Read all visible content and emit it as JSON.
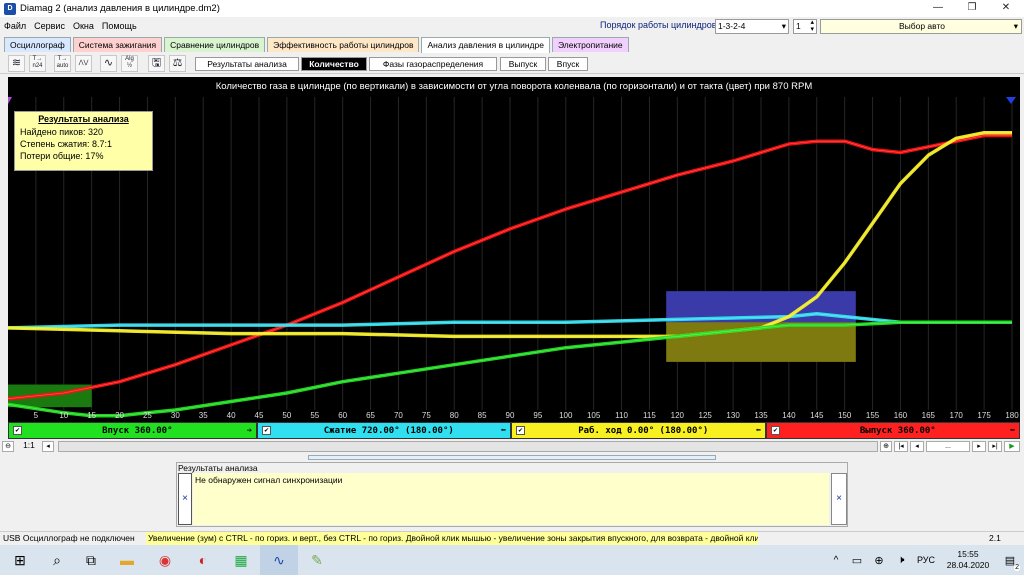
{
  "window": {
    "title": "Diamag 2 (анализ давления в цилиндре.dm2)",
    "minimize": "—",
    "maximize": "❐",
    "close": "✕"
  },
  "menu": [
    "Файл",
    "Сервис",
    "Окна",
    "Помощь"
  ],
  "cylinder_order": {
    "label": "Порядок работы цилиндров",
    "order_value": "1-3-2-4",
    "cylinder_value": "1",
    "auto_select": "Выбор авто"
  },
  "tabs": [
    {
      "label": "Осциллограф",
      "color": "#d7e8ff"
    },
    {
      "label": "Система зажигания",
      "color": "#ffd0d0"
    },
    {
      "label": "Сравнение цилиндров",
      "color": "#d8f5d0"
    },
    {
      "label": "Эффективность работы цилиндров",
      "color": "#ffe8c8"
    },
    {
      "label": "Анализ давления в цилиндре",
      "color": "#ffffff"
    },
    {
      "label": "Электропитание",
      "color": "#f1d0ff"
    }
  ],
  "toolbar_icons": [
    {
      "name": "oscillo-icon",
      "text": "≋"
    },
    {
      "name": "t-n24-icon",
      "text": "T→ n24"
    },
    {
      "name": "t-auto-icon",
      "text": "T→ auto"
    },
    {
      "name": "signal-icon",
      "text": "⋀⋁"
    },
    {
      "name": "graph-icon",
      "text": "∿"
    },
    {
      "name": "alg-half-icon",
      "text": "Alg ½"
    },
    {
      "name": "save-icon",
      "text": "🖫"
    },
    {
      "name": "scales-icon",
      "text": "⚖"
    }
  ],
  "subtabs": [
    "Результаты анализа",
    "Количество",
    "Фазы газораспределения",
    "Выпуск",
    "Впуск"
  ],
  "plot": {
    "title": "Количество газа в цилиндре (по вертикали) в зависимости от угла поворота коленвала (по горизонтали) и от такта (цвет) при 870 RPM"
  },
  "results_box": {
    "title": "Результаты анализа",
    "lines": [
      "Найдено пиков: 320",
      "Степень сжатия: 8.7:1",
      "Потери общие: 17%"
    ]
  },
  "chart_data": {
    "type": "line",
    "title": "Количество газа в цилиндре (по вертикали) в зависимости от угла поворота коленвала (по горизонтали) и от такта (цвет) при 870 RPM",
    "xlabel": "",
    "ylabel": "",
    "xlim": [
      0,
      180
    ],
    "ylim": [
      0,
      100
    ],
    "x_ticks": [
      5,
      10,
      15,
      20,
      25,
      30,
      35,
      40,
      45,
      50,
      55,
      60,
      65,
      70,
      75,
      80,
      85,
      90,
      95,
      100,
      105,
      110,
      115,
      120,
      125,
      130,
      135,
      140,
      145,
      150,
      155,
      160,
      165,
      170,
      175,
      180
    ],
    "grid": true,
    "series": [
      {
        "name": "Выпуск",
        "color": "#ff1010",
        "x": [
          0,
          10,
          20,
          30,
          40,
          50,
          60,
          70,
          80,
          90,
          100,
          110,
          120,
          130,
          140,
          145,
          150,
          155,
          160,
          165,
          170,
          175,
          180
        ],
        "y": [
          4,
          6,
          10,
          16,
          23,
          30,
          38,
          47,
          56,
          64,
          71,
          77,
          83,
          88,
          94,
          95,
          95,
          92,
          91,
          93,
          95,
          97,
          97
        ]
      },
      {
        "name": "Сжатие",
        "color": "#30e0f0",
        "x": [
          0,
          20,
          40,
          60,
          80,
          100,
          120,
          140,
          145,
          150,
          160,
          170,
          180
        ],
        "y": [
          29,
          30,
          30,
          30,
          31,
          31,
          32,
          33,
          34,
          33,
          31,
          31,
          31
        ]
      },
      {
        "name": "Раб. ход",
        "color": "#f8f020",
        "x": [
          0,
          20,
          40,
          60,
          80,
          100,
          120,
          130,
          135,
          140,
          145,
          150,
          155,
          160,
          165,
          170,
          175,
          180
        ],
        "y": [
          29,
          28,
          27,
          27,
          26,
          26,
          26,
          28,
          29,
          33,
          40,
          52,
          66,
          80,
          90,
          96,
          98,
          98
        ]
      },
      {
        "name": "Впуск",
        "color": "#20e020",
        "x": [
          0,
          10,
          15,
          20,
          25,
          30,
          40,
          50,
          60,
          70,
          80,
          90,
          100,
          110,
          120,
          130,
          140,
          150,
          160,
          170,
          180
        ],
        "y": [
          2,
          -1,
          -2,
          -2,
          -1,
          0,
          3,
          6,
          10,
          13,
          16,
          19,
          22,
          24,
          26,
          28,
          30,
          30,
          31,
          31,
          31
        ]
      }
    ],
    "zones": [
      {
        "color": "#1a7a10",
        "x": [
          0,
          15
        ],
        "y": [
          1,
          9
        ]
      },
      {
        "color": "#3a3aa8",
        "x": [
          118,
          152
        ],
        "y": [
          30,
          42
        ]
      },
      {
        "color": "#7f7a10",
        "x": [
          118,
          152
        ],
        "y": [
          17,
          31
        ]
      }
    ]
  },
  "strokes": [
    {
      "label": "Впуск 360.00°",
      "color": "#20e020",
      "check": "✔",
      "arrow": "➔"
    },
    {
      "label": "Сжатие 720.00° (180.00°)",
      "color": "#30e0f0",
      "check": "✔",
      "arrow": "⬅"
    },
    {
      "label": "Раб. ход 0.00° (180.00°)",
      "color": "#f8f020",
      "check": "✔",
      "arrow": "⬅"
    },
    {
      "label": "Выпуск 360.00°",
      "color": "#ff2020",
      "check": "✔",
      "arrow": "⬅"
    }
  ],
  "nav": {
    "zoom": "1:1",
    "dots": "..."
  },
  "results_panel": {
    "header": "Результаты анализа",
    "message": "Не обнаружен сигнал синхронизации",
    "close": "×"
  },
  "status": {
    "usb": "USB Осциллограф не подключен",
    "hint": "Увеличение (зум) с CTRL - по гориз. и верт., без CTRL - по гориз.  Двойной клик мышью - увеличение зоны закрытия впускного, для возврата - двойной клик",
    "version": "2.1"
  },
  "taskbar": {
    "lang": "РУС",
    "time": "15:55",
    "date": "28.04.2020",
    "notif": "2"
  }
}
